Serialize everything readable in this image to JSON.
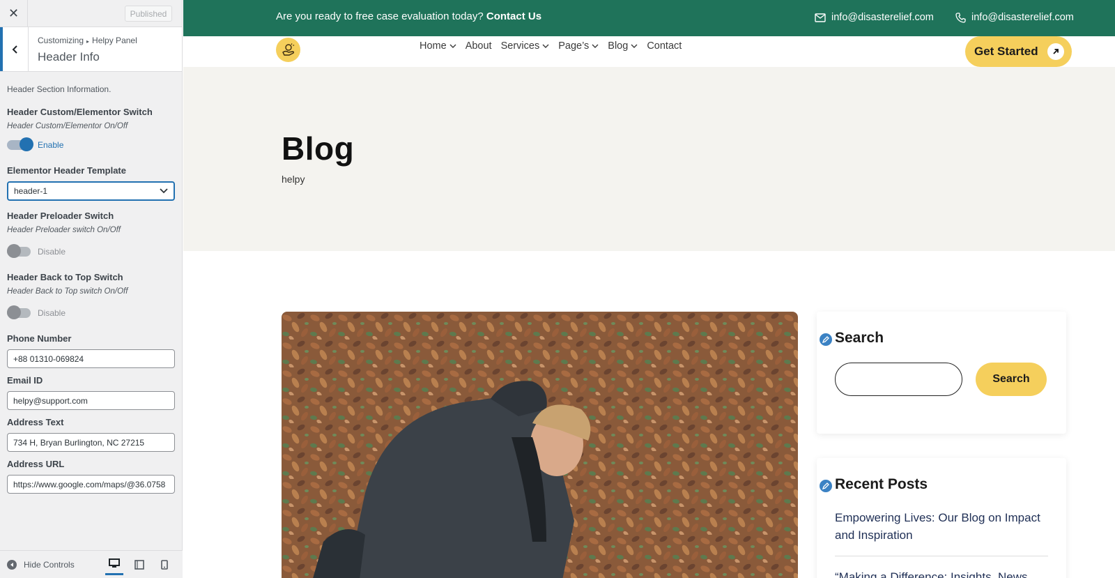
{
  "customizer": {
    "close_icon": "close-icon",
    "published_label": "Published",
    "breadcrumb_root": "Customizing",
    "breadcrumb_parent": "Helpy Panel",
    "section_title": "Header Info",
    "section_description": "Header Section Information.",
    "controls": {
      "elementor_switch": {
        "label": "Header Custom/Elementor Switch",
        "description": "Header Custom/Elementor On/Off",
        "state_label": "Enable",
        "on": true
      },
      "elementor_template": {
        "label": "Elementor Header Template",
        "selected": "header-1"
      },
      "preloader_switch": {
        "label": "Header Preloader Switch",
        "description": "Header Preloader switch On/Off",
        "state_label": "Disable",
        "on": false
      },
      "back_to_top_switch": {
        "label": "Header Back to Top Switch",
        "description": "Header Back to Top switch On/Off",
        "state_label": "Disable",
        "on": false
      },
      "phone": {
        "label": "Phone Number",
        "value": "+88 01310-069824"
      },
      "email": {
        "label": "Email ID",
        "value": "helpy@support.com"
      },
      "address": {
        "label": "Address Text",
        "value": "734 H, Bryan Burlington, NC 27215"
      },
      "address_url": {
        "label": "Address URL",
        "value": "https://www.google.com/maps/@36.0758"
      }
    },
    "footer": {
      "hide_controls_label": "Hide Controls",
      "active_device": "desktop"
    },
    "colors": {
      "accent": "#2271b1",
      "panel_bg": "#f0f0f1"
    }
  },
  "site": {
    "topbar": {
      "message": "Are you ready to free case evaluation today?",
      "message_link": "Contact Us",
      "email_1": "info@disasterelief.com",
      "email_2": "info@disasterelief.com"
    },
    "nav": {
      "items": [
        {
          "label": "Home",
          "dropdown": true
        },
        {
          "label": "About",
          "dropdown": false
        },
        {
          "label": "Services",
          "dropdown": true
        },
        {
          "label": "Page’s",
          "dropdown": true
        },
        {
          "label": "Blog",
          "dropdown": true
        },
        {
          "label": "Contact",
          "dropdown": false
        }
      ],
      "cta": "Get Started"
    },
    "hero": {
      "title": "Blog",
      "subtitle": "helpy"
    },
    "sidebar": {
      "search_title": "Search",
      "search_button": "Search",
      "recent_title": "Recent Posts",
      "recent_posts": [
        "Empowering Lives: Our Blog on Impact and Inspiration",
        "“Making a Difference: Insights, News"
      ]
    },
    "colors": {
      "brand_green": "#1f735a",
      "brand_yellow": "#f5cf5c",
      "hero_bg": "#f4f3ef"
    }
  }
}
